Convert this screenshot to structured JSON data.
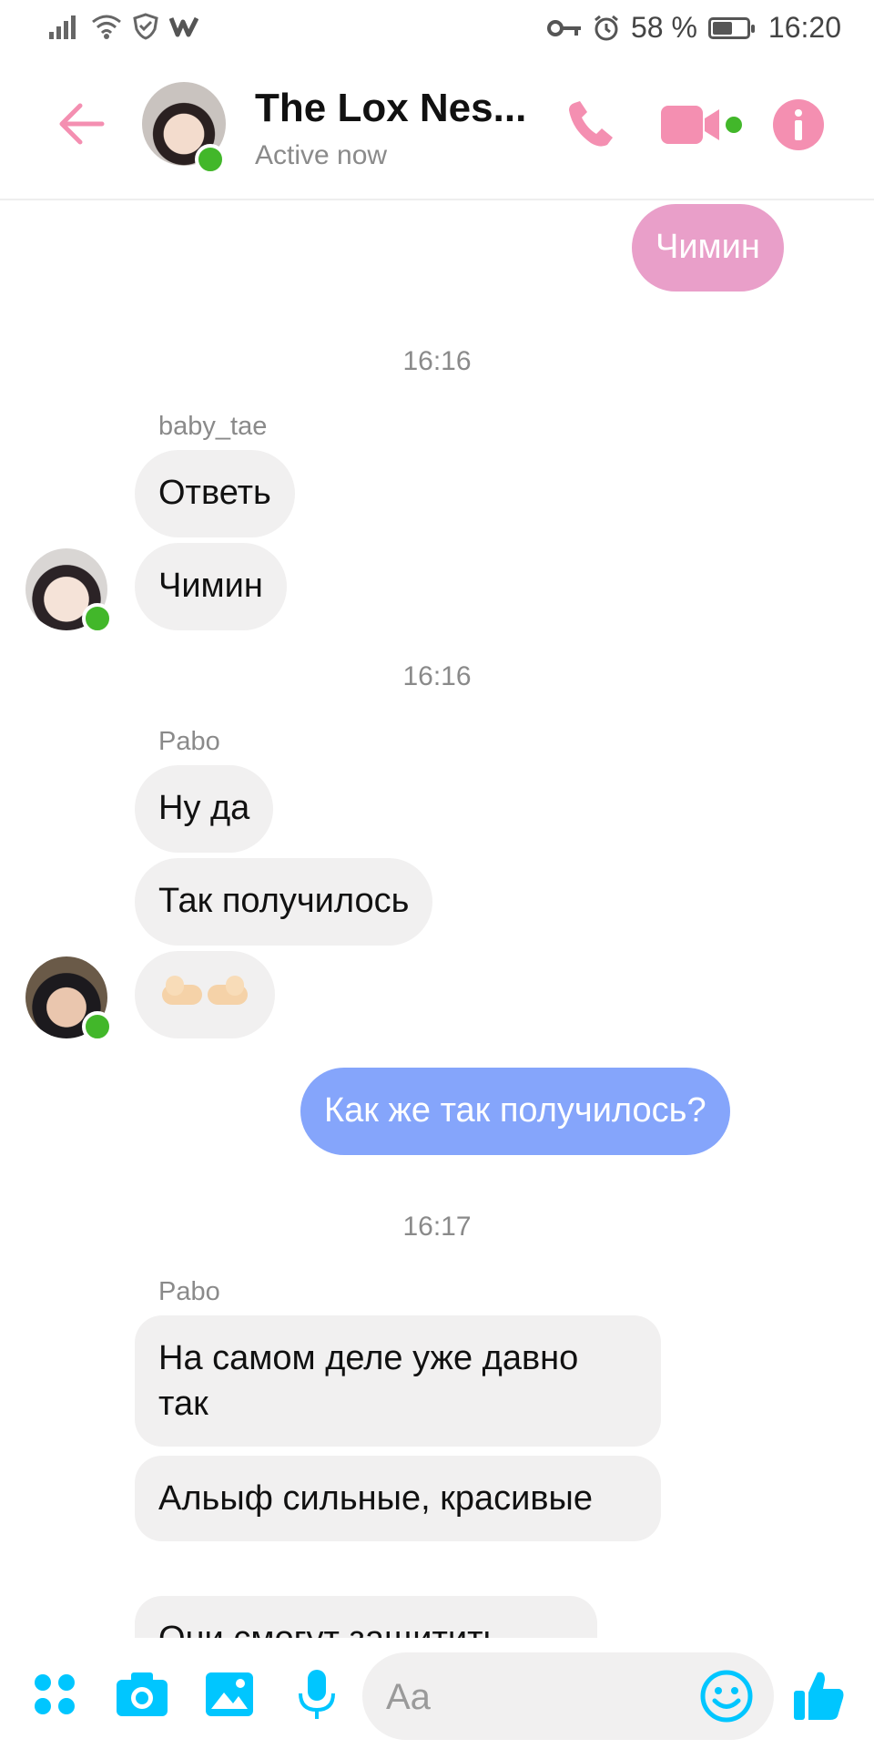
{
  "status_bar": {
    "battery_percent": "58 %",
    "battery_level": 0.58,
    "time": "16:20",
    "icons": [
      "signal-icon",
      "wifi-icon",
      "shield-icon",
      "w-app-icon",
      "key-icon",
      "alarm-icon",
      "battery-icon"
    ]
  },
  "header": {
    "title": "The Lox Nes...",
    "status": "Active now",
    "icons": [
      "back-arrow-icon",
      "phone-icon",
      "video-camera-icon",
      "info-icon"
    ]
  },
  "colors": {
    "accent_pink": "#f48fb1",
    "accent_blue": "#00c6ff",
    "bubble_pink": "#e99fc9",
    "bubble_blue": "#85a5fb",
    "bubble_gray": "#f1f0f0",
    "online_green": "#42b72a"
  },
  "messages": {
    "m1": "Чимин",
    "ts1": "16:16",
    "sender1": "baby_tae",
    "m2": "Ответь",
    "m3": "Чимин",
    "ts2": "16:16",
    "sender2": "Pabo",
    "m4": "Ну да",
    "m5": "Так получилось",
    "m6_emoji": "pointing-fingers-emoji",
    "m7": "Как же так получилось?",
    "ts3": "16:17",
    "sender3": "Pabo",
    "m8": "На самом деле уже давно так",
    "m9": "Альыф сильные, красивые",
    "m10": "Они смогут защитить"
  },
  "composer": {
    "placeholder": "Aa",
    "icons": [
      "menu-dots-icon",
      "camera-icon",
      "image-icon",
      "microphone-icon",
      "emoji-icon",
      "thumbs-up-icon"
    ]
  }
}
